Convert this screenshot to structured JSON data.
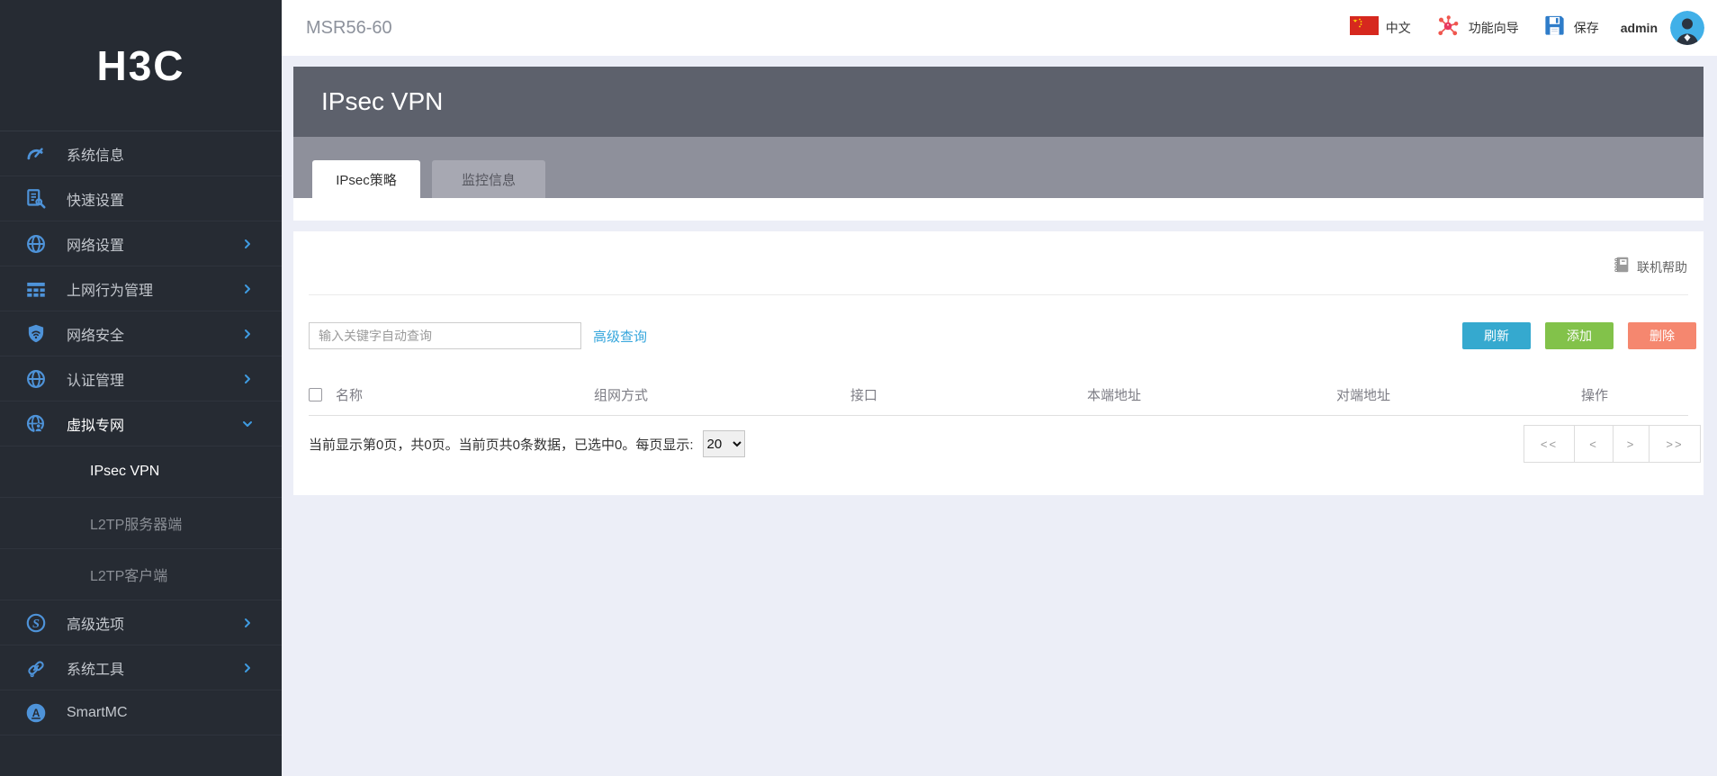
{
  "topbar": {
    "device_name": "MSR56-60",
    "language_label": "中文",
    "wizard_label": "功能向导",
    "save_label": "保存",
    "user": "admin"
  },
  "sidebar": {
    "logo_text": "H3C",
    "items": [
      {
        "label": "系统信息",
        "icon": "gauge-icon",
        "chevron": "none",
        "active": false
      },
      {
        "label": "快速设置",
        "icon": "quick-setup-icon",
        "chevron": "none",
        "active": false
      },
      {
        "label": "网络设置",
        "icon": "globe-icon",
        "chevron": "right",
        "active": false
      },
      {
        "label": "上网行为管理",
        "icon": "behavior-grid-icon",
        "chevron": "right",
        "active": false
      },
      {
        "label": "网络安全",
        "icon": "shield-wifi-icon",
        "chevron": "right",
        "active": false
      },
      {
        "label": "认证管理",
        "icon": "globe-icon",
        "chevron": "right",
        "active": false
      },
      {
        "label": "虚拟专网",
        "icon": "vpn-globe-icon",
        "chevron": "down",
        "active": true
      },
      {
        "label": "IPsec VPN",
        "icon": "none",
        "submenu": true,
        "active": true
      },
      {
        "label": "L2TP服务器端",
        "icon": "none",
        "submenu": true,
        "active": false
      },
      {
        "label": "L2TP客户端",
        "icon": "none",
        "submenu": true,
        "active": false
      },
      {
        "label": "高级选项",
        "icon": "advanced-icon",
        "chevron": "right",
        "active": false
      },
      {
        "label": "系统工具",
        "icon": "tools-icon",
        "chevron": "right",
        "active": false
      },
      {
        "label": "SmartMC",
        "icon": "smartmc-icon",
        "chevron": "none",
        "active": false
      }
    ]
  },
  "page": {
    "title": "IPsec VPN",
    "tabs": [
      {
        "label": "IPsec策略",
        "active": true
      },
      {
        "label": "监控信息",
        "active": false
      }
    ]
  },
  "content": {
    "help_label": "联机帮助",
    "search_placeholder": "输入关键字自动查询",
    "advanced_search_label": "高级查询",
    "buttons": {
      "refresh": "刷新",
      "add": "添加",
      "delete": "删除"
    },
    "table": {
      "headers": [
        "名称",
        "组网方式",
        "接口",
        "本端地址",
        "对端地址",
        "操作"
      ],
      "rows": []
    },
    "pagination": {
      "summary": "当前显示第0页，共0页。当前页共0条数据，已选中0。每页显示:",
      "page_size": "20",
      "pager": [
        "<<",
        "<",
        ">",
        ">>"
      ]
    }
  },
  "colors": {
    "sidebar_bg": "#262b33",
    "banner_bg": "#5d616c",
    "tabstrip_bg": "#8e909b",
    "page_bg": "#eceef7",
    "accent_blue": "#36a6dc",
    "icon_blue": "#4e93d9",
    "btn_refresh": "#35a9cf",
    "btn_add": "#82c24a",
    "btn_delete": "#f5876f"
  }
}
